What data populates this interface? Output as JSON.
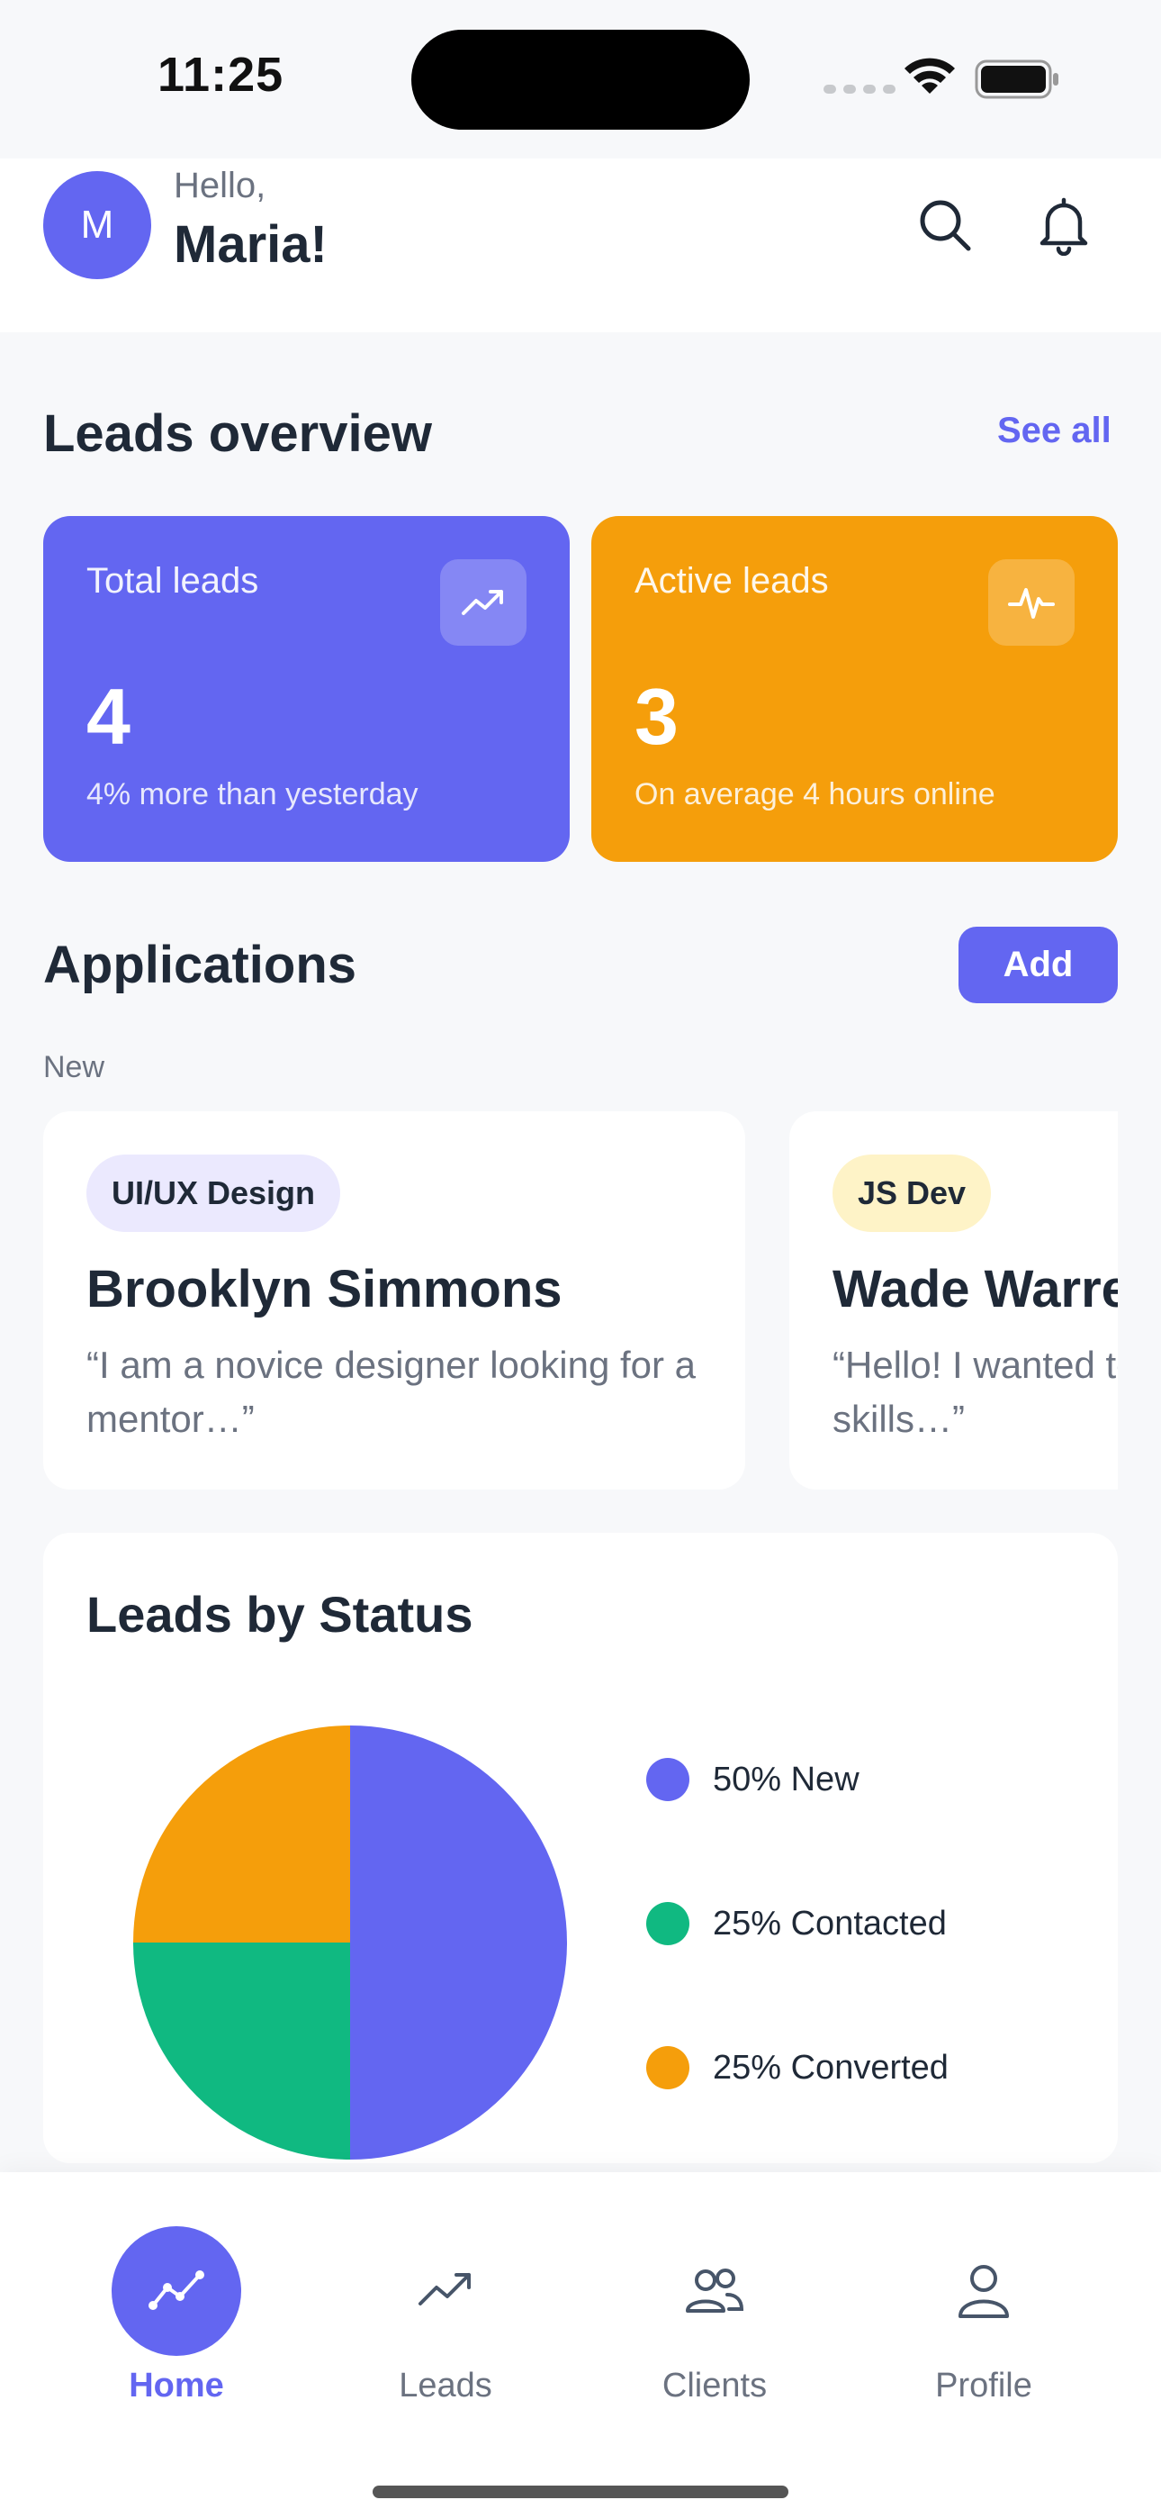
{
  "status_bar": {
    "time": "11:25"
  },
  "header": {
    "avatar_initial": "M",
    "greeting": "Hello,",
    "name": "Maria!"
  },
  "overview": {
    "title": "Leads overview",
    "see_all": "See all",
    "cards": [
      {
        "label": "Total leads",
        "value": "4",
        "sub": "4% more than yesterday",
        "icon": "trending-up-icon",
        "color": "#6366f1"
      },
      {
        "label": "Active leads",
        "value": "3",
        "sub": "On average 4 hours online",
        "icon": "activity-icon",
        "color": "#f59e0b"
      }
    ]
  },
  "applications": {
    "title": "Applications",
    "add_label": "Add",
    "group_label": "New",
    "items": [
      {
        "tag": "UI/UX Design",
        "name": "Brooklyn Simmons",
        "quote": "“I am a novice designer looking for a mentor…”"
      },
      {
        "tag": "JS Dev",
        "name": "Wade Warren",
        "quote": "“Hello! I wanted to improve my skills…”"
      }
    ]
  },
  "chart_data": {
    "type": "pie",
    "title": "Leads by Status",
    "slices": [
      {
        "label": "50% New",
        "name": "New",
        "value": 50,
        "color": "#6366f1"
      },
      {
        "label": "25% Contacted",
        "name": "Contacted",
        "value": 25,
        "color": "#10b981"
      },
      {
        "label": "25% Converted",
        "name": "Converted",
        "value": 25,
        "color": "#f59e0b"
      }
    ],
    "legend_position": "right"
  },
  "nav": {
    "items": [
      {
        "label": "Home",
        "icon": "home-chart-icon",
        "active": true
      },
      {
        "label": "Leads",
        "icon": "trending-up-icon",
        "active": false
      },
      {
        "label": "Clients",
        "icon": "users-icon",
        "active": false
      },
      {
        "label": "Profile",
        "icon": "user-icon",
        "active": false
      }
    ]
  },
  "colors": {
    "accent": "#6366f1",
    "warning": "#f59e0b",
    "success": "#10b981",
    "background": "#f7f8fa"
  }
}
